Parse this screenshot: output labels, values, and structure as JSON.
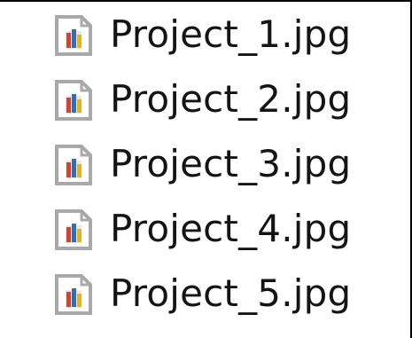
{
  "file_list": {
    "items": [
      {
        "name": "Project_1.jpg",
        "icon": "image-file-icon"
      },
      {
        "name": "Project_2.jpg",
        "icon": "image-file-icon"
      },
      {
        "name": "Project_3.jpg",
        "icon": "image-file-icon"
      },
      {
        "name": "Project_4.jpg",
        "icon": "image-file-icon"
      },
      {
        "name": "Project_5.jpg",
        "icon": "image-file-icon"
      }
    ]
  },
  "colors": {
    "border": "#000000",
    "text": "#141414",
    "icon_frame": "#a9a9a9",
    "icon_page": "#ffffff",
    "icon_red": "#d6402f",
    "icon_blue": "#2f6fb8",
    "icon_yellow": "#e6b422"
  }
}
